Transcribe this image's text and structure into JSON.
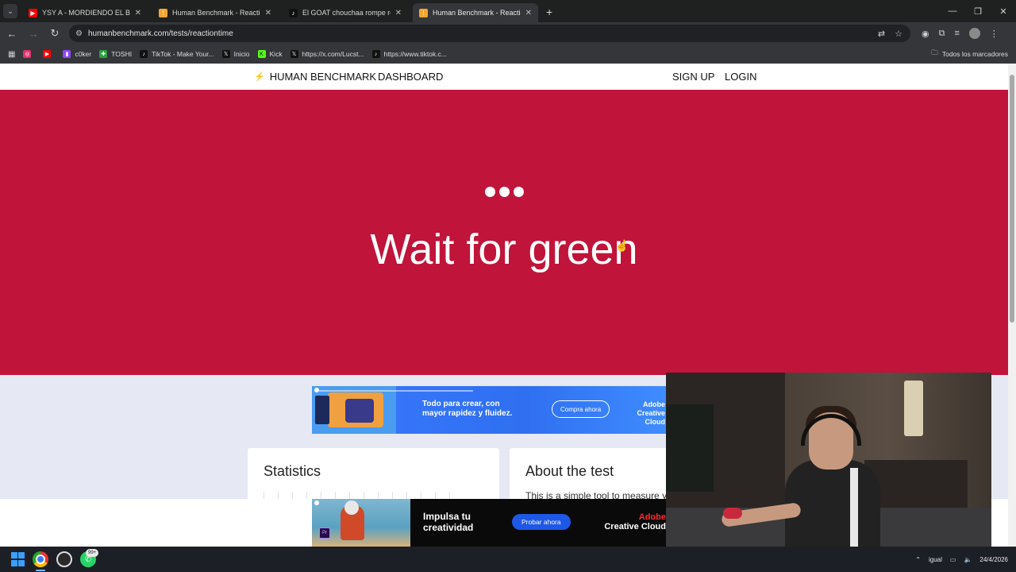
{
  "browser": {
    "tabs": [
      {
        "title": "YSY A - MORDIENDO EL BOZAL",
        "favicon_color": "#ff0000",
        "active": false
      },
      {
        "title": "Human Benchmark - Reaction T",
        "favicon_color": "#f3a533",
        "active": false
      },
      {
        "title": "El GOAT chouchaa rompe récor",
        "favicon_color": "#111111",
        "active": false
      },
      {
        "title": "Human Benchmark - Reaction T",
        "favicon_color": "#f3a533",
        "active": true
      }
    ],
    "url": "humanbenchmark.com/tests/reactiontime",
    "bookmarks": [
      {
        "label": "",
        "color": "#e1306c"
      },
      {
        "label": "",
        "color": "#ff0000"
      },
      {
        "label": "c0ker",
        "color": "#9146ff"
      },
      {
        "label": "TOSHI",
        "color": "#2e9e44"
      },
      {
        "label": "TikTok - Make Your...",
        "color": "#111111"
      },
      {
        "label": "Inicio",
        "color": "#111111"
      },
      {
        "label": "Kick",
        "color": "#53fc18"
      },
      {
        "label": "https://x.com/Lucst...",
        "color": "#111111"
      },
      {
        "label": "https://www.tiktok.c...",
        "color": "#111111"
      }
    ],
    "all_bookmarks_label": "Todos los marcadores"
  },
  "site": {
    "brand": "HUMAN BENCHMARK",
    "nav_dashboard": "DASHBOARD",
    "nav_signup": "SIGN UP",
    "nav_login": "LOGIN",
    "test_bg_color": "#c0143a",
    "headline": "Wait for green",
    "statistics_title": "Statistics",
    "about_title": "About the test",
    "about_text": "This is a simple tool to measure y"
  },
  "ads": {
    "top": {
      "text_line1": "Todo para crear, con",
      "text_line2": "mayor rapidez y fluidez.",
      "cta": "Compra ahora",
      "brand_line1": "Adobe",
      "brand_line2": "Creative Cloud"
    },
    "bottom": {
      "text_line1": "Impulsa tu",
      "text_line2": "creatividad",
      "cta": "Probar ahora",
      "brand_line1": "Adobe",
      "brand_line2": "Creative Cloud",
      "badge": "Pr"
    }
  },
  "taskbar": {
    "whatsapp_badge": "99+",
    "tray_text": "igual",
    "date": "24/4/2026"
  }
}
